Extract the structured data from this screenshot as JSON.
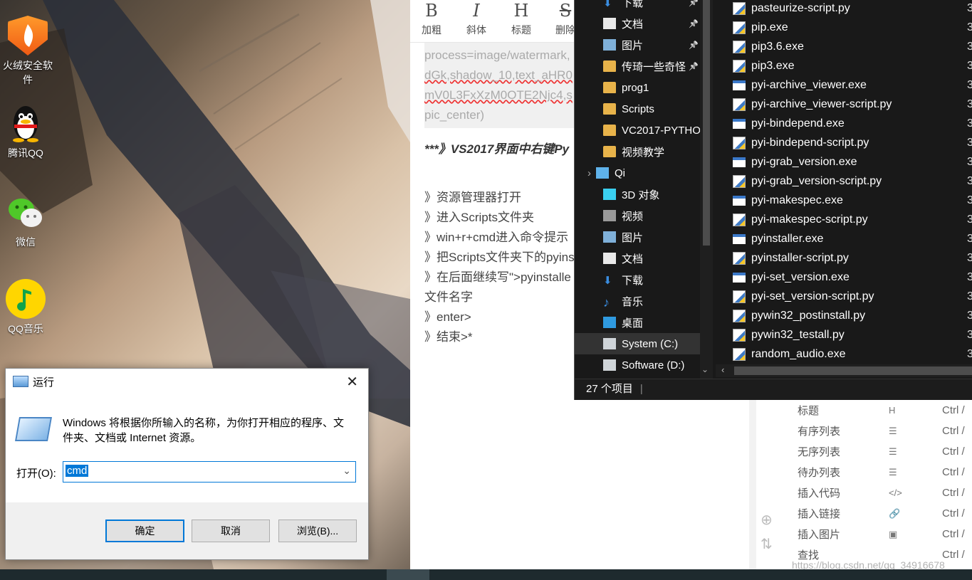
{
  "desktop": {
    "icons": [
      {
        "label": "火绒安全软件",
        "icon": "huorong-icon"
      },
      {
        "label": "腾讯QQ",
        "icon": "qq-penguin-icon"
      },
      {
        "label": "微信",
        "icon": "wechat-icon"
      },
      {
        "label": "QQ音乐",
        "icon": "qqmusic-icon"
      }
    ]
  },
  "editor": {
    "toolbar": [
      {
        "glyph": "B",
        "label": "加粗"
      },
      {
        "glyph": "I",
        "label": "斜体"
      },
      {
        "glyph": "H",
        "label": "标题"
      },
      {
        "glyph": "S",
        "label": "删除"
      }
    ],
    "quote_lines": [
      "process=image/watermark,",
      "dGk,shadow_10,text_aHR0",
      "mV0L3FxXzM0OTE2Njc4,s",
      "pic_center)"
    ],
    "heading": "***》VS2017界面中右键Py",
    "steps": [
      "》资源管理器打开",
      "》进入Scripts文件夹",
      "》win+r+cmd进入命令提示",
      "》把Scripts文件夹下的pyins",
      "》在后面继续写\">pyinstalle",
      "文件名字",
      "》enter>",
      "》结束>*"
    ],
    "shortcuts": [
      {
        "name": "标题",
        "icon": "H",
        "key": "Ctrl /"
      },
      {
        "name": "有序列表",
        "icon": "☰",
        "key": "Ctrl /"
      },
      {
        "name": "无序列表",
        "icon": "☰",
        "key": "Ctrl /"
      },
      {
        "name": "待办列表",
        "icon": "☰",
        "key": "Ctrl /"
      },
      {
        "name": "插入代码",
        "icon": "</>",
        "key": "Ctrl /"
      },
      {
        "name": "插入链接",
        "icon": "🔗",
        "key": "Ctrl /"
      },
      {
        "name": "插入图片",
        "icon": "▣",
        "key": "Ctrl /"
      },
      {
        "name": "查找",
        "icon": "",
        "key": "Ctrl /"
      }
    ],
    "watermark": "https://blog.csdn.net/qq_34916678"
  },
  "explorer": {
    "nav": [
      {
        "label": "下载",
        "icon": "download-icon",
        "pinned": true,
        "indent": 1
      },
      {
        "label": "文档",
        "icon": "document-icon",
        "pinned": true,
        "indent": 1
      },
      {
        "label": "图片",
        "icon": "picture-icon",
        "pinned": true,
        "indent": 1
      },
      {
        "label": "传琦一些奇怪",
        "icon": "folder-icon",
        "pinned": true,
        "indent": 1
      },
      {
        "label": "prog1",
        "icon": "folder-icon",
        "pinned": false,
        "indent": 1
      },
      {
        "label": "Scripts",
        "icon": "folder-icon",
        "pinned": false,
        "indent": 1
      },
      {
        "label": "VC2017-PYTHO",
        "icon": "folder-icon",
        "pinned": false,
        "indent": 1
      },
      {
        "label": "视频教学",
        "icon": "folder-icon",
        "pinned": false,
        "indent": 1
      },
      {
        "label": "Qi",
        "icon": "computer-icon",
        "pinned": false,
        "indent": 0
      },
      {
        "label": "3D 对象",
        "icon": "cube-icon",
        "pinned": false,
        "indent": 1
      },
      {
        "label": "视频",
        "icon": "video-icon",
        "pinned": false,
        "indent": 1
      },
      {
        "label": "图片",
        "icon": "picture-icon",
        "pinned": false,
        "indent": 1
      },
      {
        "label": "文档",
        "icon": "document-icon",
        "pinned": false,
        "indent": 1
      },
      {
        "label": "下载",
        "icon": "download-icon",
        "pinned": false,
        "indent": 1
      },
      {
        "label": "音乐",
        "icon": "music-icon",
        "pinned": false,
        "indent": 1
      },
      {
        "label": "桌面",
        "icon": "desktop-icon",
        "pinned": false,
        "indent": 1
      },
      {
        "label": "System (C:)",
        "icon": "drive-icon",
        "pinned": false,
        "indent": 1,
        "selected": true
      },
      {
        "label": "Software (D:)",
        "icon": "drive-icon",
        "pinned": false,
        "indent": 1
      }
    ],
    "files": [
      {
        "name": "pasteurize-script.py",
        "type": "py",
        "date": "3/"
      },
      {
        "name": "pip.exe",
        "type": "py",
        "date": "3/"
      },
      {
        "name": "pip3.6.exe",
        "type": "py",
        "date": "3/"
      },
      {
        "name": "pip3.exe",
        "type": "py",
        "date": "3/"
      },
      {
        "name": "pyi-archive_viewer.exe",
        "type": "exe",
        "date": "3/"
      },
      {
        "name": "pyi-archive_viewer-script.py",
        "type": "py",
        "date": "3/"
      },
      {
        "name": "pyi-bindepend.exe",
        "type": "exe",
        "date": "3/"
      },
      {
        "name": "pyi-bindepend-script.py",
        "type": "py",
        "date": "3/"
      },
      {
        "name": "pyi-grab_version.exe",
        "type": "exe",
        "date": "3/"
      },
      {
        "name": "pyi-grab_version-script.py",
        "type": "py",
        "date": "3/"
      },
      {
        "name": "pyi-makespec.exe",
        "type": "exe",
        "date": "3/"
      },
      {
        "name": "pyi-makespec-script.py",
        "type": "py",
        "date": "3/"
      },
      {
        "name": "pyinstaller.exe",
        "type": "exe",
        "date": "3/"
      },
      {
        "name": "pyinstaller-script.py",
        "type": "py",
        "date": "3/"
      },
      {
        "name": "pyi-set_version.exe",
        "type": "exe",
        "date": "3/"
      },
      {
        "name": "pyi-set_version-script.py",
        "type": "py",
        "date": "3/"
      },
      {
        "name": "pywin32_postinstall.py",
        "type": "py",
        "date": "3/"
      },
      {
        "name": "pywin32_testall.py",
        "type": "py",
        "date": "3/"
      },
      {
        "name": "random_audio.exe",
        "type": "py",
        "date": "3/"
      }
    ],
    "status": "27 个项目"
  },
  "run": {
    "title": "运行",
    "description": "Windows 将根据你所输入的名称，为你打开相应的程序、文件夹、文档或 Internet 资源。",
    "open_label": "打开(O):",
    "value": "cmd",
    "ok": "确定",
    "cancel": "取消",
    "browse": "浏览(B)..."
  },
  "colors": {
    "accent": "#0078d7",
    "explorer_bg": "#191919",
    "selected_nav": "#333333"
  }
}
